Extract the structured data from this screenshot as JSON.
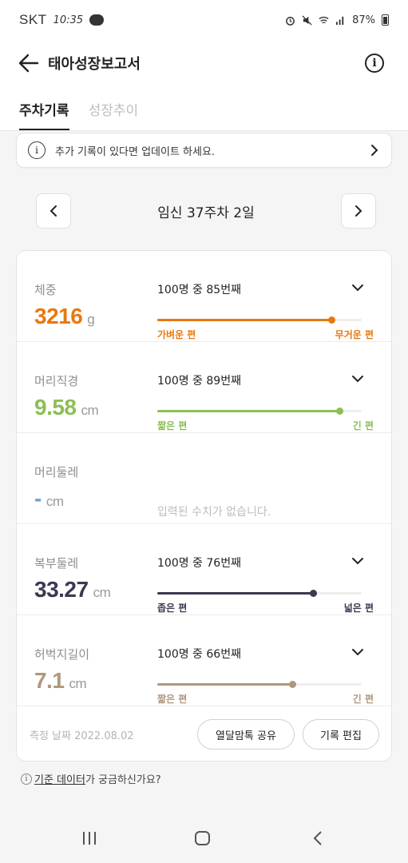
{
  "status": {
    "carrier": "SKT",
    "time": "10:35",
    "battery": "87%"
  },
  "header": {
    "title": "태아성장보고서"
  },
  "tabs": [
    {
      "label": "주차기록",
      "active": true
    },
    {
      "label": "성장추이",
      "active": false
    }
  ],
  "notice": {
    "text": "추가 기록이 있다면 업데이트 하세요."
  },
  "week": {
    "label": "임신 37주차 2일"
  },
  "colors": {
    "orange": "#e8780f",
    "green": "#8cbf55",
    "navy": "#3a3950",
    "tan": "#b0977c"
  },
  "metrics": [
    {
      "label": "체중",
      "value": "3216",
      "unit": "g",
      "rank": "100명 중 85번째",
      "percentile": 0.85,
      "low": "가벼운 편",
      "high": "무거운 편",
      "color": "#e8780f"
    },
    {
      "label": "머리직경",
      "value": "9.58",
      "unit": "cm",
      "rank": "100명 중 89번째",
      "percentile": 0.89,
      "low": "짧은 편",
      "high": "긴 편",
      "color": "#8cbf55"
    },
    {
      "label": "머리둘레",
      "value": "-",
      "unit": "cm",
      "empty": "입력된 수치가 없습니다.",
      "color": "#6e9fd8"
    },
    {
      "label": "복부둘레",
      "value": "33.27",
      "unit": "cm",
      "rank": "100명 중 76번째",
      "percentile": 0.76,
      "low": "좁은 편",
      "high": "넓은 편",
      "color": "#3a3950"
    },
    {
      "label": "허벅지길이",
      "value": "7.1",
      "unit": "cm",
      "rank": "100명 중 66번째",
      "percentile": 0.66,
      "low": "짧은 편",
      "high": "긴 편",
      "color": "#b0977c"
    }
  ],
  "footer": {
    "date": "측정 날짜 2022.08.02",
    "share": "열달맘톡 공유",
    "edit": "기록 편집"
  },
  "help": {
    "link": "기준 데이터",
    "rest": "가 궁금하신가요?"
  }
}
